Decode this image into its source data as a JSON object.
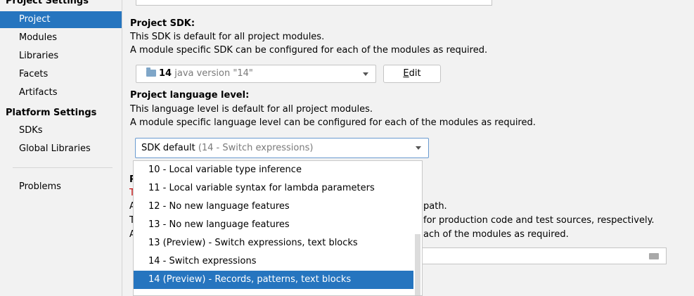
{
  "sidebar": {
    "project_settings_title": "Project Settings",
    "project_items": [
      "Project",
      "Modules",
      "Libraries",
      "Facets",
      "Artifacts"
    ],
    "platform_settings_title": "Platform Settings",
    "platform_items": [
      "SDKs",
      "Global Libraries"
    ],
    "problems_label": "Problems",
    "selected": "Project"
  },
  "sdk": {
    "heading": "Project SDK:",
    "line1": "This SDK is default for all project modules.",
    "line2": "A module specific SDK can be configured for each of the modules as required.",
    "combo_number": "14",
    "combo_version": "java version \"14\"",
    "edit_button_mnemonic": "E",
    "edit_button_rest": "dit"
  },
  "language_level": {
    "heading": "Project language level:",
    "line1": "This language level is default for all project modules.",
    "line2": "A module specific language level can be configured for each of the modules as required.",
    "combo_main": "SDK default",
    "combo_hint": "(14 - Switch expressions)",
    "options": [
      "10 - Local variable type inference",
      "11 - Local variable syntax for lambda parameters",
      "12 - No new language features",
      "13 - No new language features",
      "13 (Preview) - Switch expressions, text blocks",
      "14 - Switch expressions",
      "14 (Preview) - Records, patterns, text blocks"
    ],
    "highlighted_option": "14 (Preview) - Records, patterns, text blocks"
  },
  "obscured_text": {
    "letter_p": "P",
    "letter_t1": "T",
    "letter_a1": "A",
    "letter_t2": "T",
    "letter_a2": "A",
    "path_frag": "path.",
    "prod_frag": "for production code and test sources, respectively.",
    "modules_frag": "ach of the modules as required."
  },
  "colors": {
    "selection": "#2675bf",
    "background": "#f2f2f2"
  }
}
